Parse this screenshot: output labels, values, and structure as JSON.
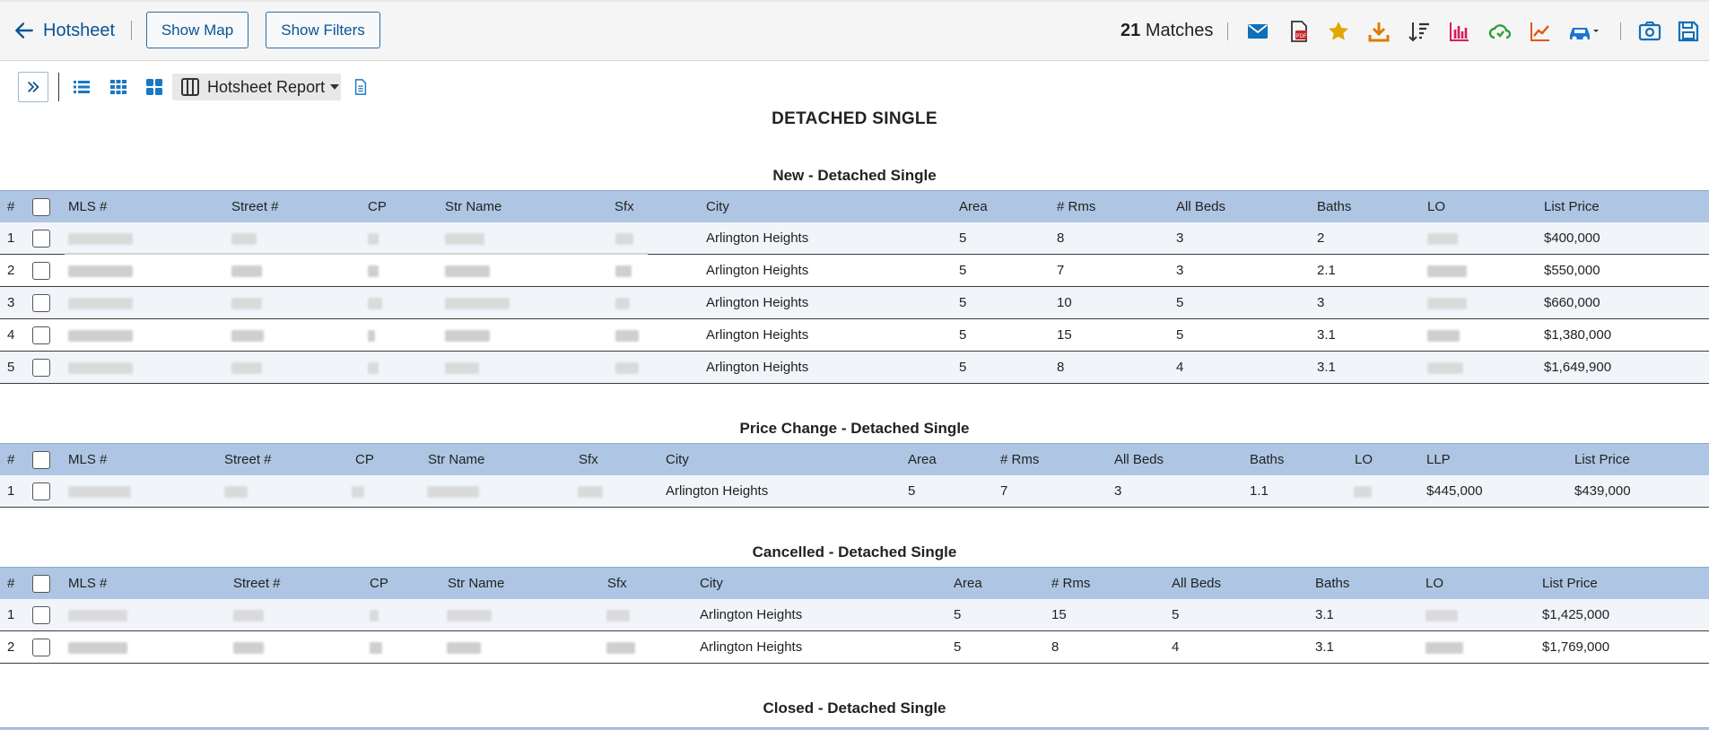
{
  "header": {
    "back_label": "Hotsheet",
    "show_map": "Show Map",
    "show_filters": "Show Filters",
    "matches_count": "21",
    "matches_label": "Matches",
    "icons": [
      "email-icon",
      "pdf-icon",
      "star-icon",
      "download-icon",
      "sort-icon",
      "bar-chart-icon",
      "cloud-sync-icon",
      "line-chart-icon",
      "car-icon",
      "camera-search-icon",
      "save-icon"
    ]
  },
  "toolbar": {
    "report_label": "Hotsheet Report"
  },
  "page_title": "DETACHED SINGLE",
  "sections": {
    "new": {
      "title": "New - Detached Single",
      "headers": [
        "#",
        "MLS #",
        "Street #",
        "CP",
        "Str Name",
        "Sfx",
        "City",
        "Area",
        "# Rms",
        "All Beds",
        "Baths",
        "LO",
        "List Price"
      ],
      "rows": [
        {
          "n": "1",
          "city": "Arlington Heights",
          "area": "5",
          "rms": "8",
          "beds": "3",
          "baths": "2",
          "price": "$400,000"
        },
        {
          "n": "2",
          "city": "Arlington Heights",
          "area": "5",
          "rms": "7",
          "beds": "3",
          "baths": "2.1",
          "price": "$550,000"
        },
        {
          "n": "3",
          "city": "Arlington Heights",
          "area": "5",
          "rms": "10",
          "beds": "5",
          "baths": "3",
          "price": "$660,000"
        },
        {
          "n": "4",
          "city": "Arlington Heights",
          "area": "5",
          "rms": "15",
          "beds": "5",
          "baths": "3.1",
          "price": "$1,380,000"
        },
        {
          "n": "5",
          "city": "Arlington Heights",
          "area": "5",
          "rms": "8",
          "beds": "4",
          "baths": "3.1",
          "price": "$1,649,900"
        }
      ]
    },
    "price_change": {
      "title": "Price Change - Detached Single",
      "headers": [
        "#",
        "MLS #",
        "Street #",
        "CP",
        "Str Name",
        "Sfx",
        "City",
        "Area",
        "# Rms",
        "All Beds",
        "Baths",
        "LO",
        "LLP",
        "List Price"
      ],
      "rows": [
        {
          "n": "1",
          "city": "Arlington Heights",
          "area": "5",
          "rms": "7",
          "beds": "3",
          "baths": "1.1",
          "llp": "$445,000",
          "price": "$439,000"
        }
      ]
    },
    "cancelled": {
      "title": "Cancelled - Detached Single",
      "headers": [
        "#",
        "MLS #",
        "Street #",
        "CP",
        "Str Name",
        "Sfx",
        "City",
        "Area",
        "# Rms",
        "All Beds",
        "Baths",
        "LO",
        "List Price"
      ],
      "rows": [
        {
          "n": "1",
          "city": "Arlington Heights",
          "area": "5",
          "rms": "15",
          "beds": "5",
          "baths": "3.1",
          "price": "$1,425,000"
        },
        {
          "n": "2",
          "city": "Arlington Heights",
          "area": "5",
          "rms": "8",
          "beds": "4",
          "baths": "3.1",
          "price": "$1,769,000"
        }
      ]
    },
    "closed": {
      "title": "Closed - Detached Single"
    }
  },
  "colors": {
    "accent": "#0b5394",
    "header_bg": "#aec6e3",
    "row_alt": "#f1f5fa"
  }
}
